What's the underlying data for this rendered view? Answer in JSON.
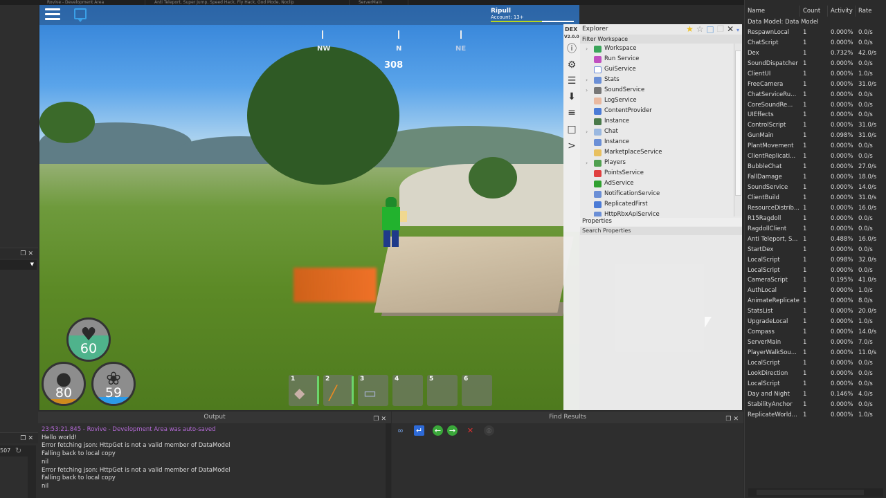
{
  "tabs": [
    {
      "label": "Rovive - Development Area"
    },
    {
      "label": "Anti Teleport, Super Jump, Speed Hack, Fly Hack, God Mode, Noclip"
    },
    {
      "label": "ServerMain"
    }
  ],
  "game": {
    "compass": {
      "labels": [
        "NW",
        "N",
        "NE"
      ],
      "heading": "308"
    },
    "player": {
      "name": "Ripull",
      "account": "Account: 13+",
      "xp_fraction": 0.62
    },
    "stats": {
      "health": {
        "value": "60",
        "fraction": 0.6,
        "color": "#4fb38c"
      },
      "hunger": {
        "value": "80",
        "fraction": 0.12,
        "color": "#d08a1c"
      },
      "thirst": {
        "value": "59",
        "fraction": 0.18,
        "color": "#2b9ae8"
      }
    },
    "hotbar": [
      {
        "num": "1",
        "item": "stone",
        "equipped": true
      },
      {
        "num": "2",
        "item": "torch",
        "equipped": true
      },
      {
        "num": "3",
        "item": "scroll",
        "equipped": false
      },
      {
        "num": "4",
        "item": "",
        "equipped": false
      },
      {
        "num": "5",
        "item": "",
        "equipped": false
      },
      {
        "num": "6",
        "item": "",
        "equipped": false
      }
    ]
  },
  "explorer": {
    "logo": "DEX",
    "version": "V2.0.0",
    "title": "Explorer",
    "filter": "Filter Workspace",
    "properties_label": "Properties",
    "search_properties": "Search Properties",
    "items": [
      {
        "label": "Workspace",
        "expandable": true,
        "icon": "#3aa55a"
      },
      {
        "label": "Run Service",
        "expandable": false,
        "icon": "#c050c0"
      },
      {
        "label": "GuiService",
        "expandable": false,
        "icon": "#ffffff"
      },
      {
        "label": "Stats",
        "expandable": true,
        "icon": "#6b8fd6"
      },
      {
        "label": "SoundService",
        "expandable": true,
        "icon": "#777777"
      },
      {
        "label": "LogService",
        "expandable": false,
        "icon": "#e9b9a0"
      },
      {
        "label": "ContentProvider",
        "expandable": false,
        "icon": "#4b7bd6"
      },
      {
        "label": "Instance",
        "expandable": false,
        "icon": "#4a7a4a"
      },
      {
        "label": "Chat",
        "expandable": true,
        "icon": "#9ab8e0"
      },
      {
        "label": "Instance",
        "expandable": false,
        "icon": "#6b8fd6"
      },
      {
        "label": "MarketplaceService",
        "expandable": false,
        "icon": "#e8c060"
      },
      {
        "label": "Players",
        "expandable": true,
        "icon": "#50a050"
      },
      {
        "label": "PointsService",
        "expandable": false,
        "icon": "#e04040"
      },
      {
        "label": "AdService",
        "expandable": false,
        "icon": "#30a030"
      },
      {
        "label": "NotificationService",
        "expandable": false,
        "icon": "#6b8fd6"
      },
      {
        "label": "ReplicatedFirst",
        "expandable": false,
        "icon": "#4b7bd6"
      },
      {
        "label": "HttpRbxApiService",
        "expandable": false,
        "icon": "#6b8fd6"
      }
    ]
  },
  "output": {
    "title": "Output",
    "lines": [
      {
        "text": "23:53:21.845 - Rovive - Development Area was auto-saved",
        "type": "sys"
      },
      {
        "text": "Hello world!",
        "type": "normal"
      },
      {
        "text": "Error fetching json: HttpGet is not a valid member of DataModel",
        "type": "normal"
      },
      {
        "text": "Falling back to local copy",
        "type": "normal"
      },
      {
        "text": "nil",
        "type": "normal"
      },
      {
        "text": "Error fetching json: HttpGet is not a valid member of DataModel",
        "type": "normal"
      },
      {
        "text": "Falling back to local copy",
        "type": "normal"
      },
      {
        "text": "nil",
        "type": "normal"
      }
    ]
  },
  "find_results": {
    "title": "Find Results"
  },
  "left_panel": {
    "counter": "507"
  },
  "script_performance": {
    "columns": [
      "Name",
      "Count",
      "Activity",
      "Rate"
    ],
    "group": "Data Model: Data Model",
    "rows": [
      [
        "RespawnLocal",
        "1",
        "0.000%",
        "0.0/s"
      ],
      [
        "ChatScript",
        "1",
        "0.000%",
        "0.0/s"
      ],
      [
        "Dex",
        "1",
        "0.732%",
        "42.0/s"
      ],
      [
        "SoundDispatcher",
        "1",
        "0.000%",
        "0.0/s"
      ],
      [
        "ClientUI",
        "1",
        "0.000%",
        "1.0/s"
      ],
      [
        "FreeCamera",
        "1",
        "0.000%",
        "31.0/s"
      ],
      [
        "ChatServiceRu...",
        "1",
        "0.000%",
        "0.0/s"
      ],
      [
        "CoreSoundRe...",
        "1",
        "0.000%",
        "0.0/s"
      ],
      [
        "UIEffects",
        "1",
        "0.000%",
        "0.0/s"
      ],
      [
        "ControlScript",
        "1",
        "0.000%",
        "31.0/s"
      ],
      [
        "GunMain",
        "1",
        "0.098%",
        "31.0/s"
      ],
      [
        "PlantMovement",
        "1",
        "0.000%",
        "0.0/s"
      ],
      [
        "ClientReplicati...",
        "1",
        "0.000%",
        "0.0/s"
      ],
      [
        "BubbleChat",
        "1",
        "0.000%",
        "27.0/s"
      ],
      [
        "FallDamage",
        "1",
        "0.000%",
        "18.0/s"
      ],
      [
        "SoundService",
        "1",
        "0.000%",
        "14.0/s"
      ],
      [
        "ClientBuild",
        "1",
        "0.000%",
        "31.0/s"
      ],
      [
        "ResourceDistrib...",
        "1",
        "0.000%",
        "16.0/s"
      ],
      [
        "R15Ragdoll",
        "1",
        "0.000%",
        "0.0/s"
      ],
      [
        "RagdollClient",
        "1",
        "0.000%",
        "0.0/s"
      ],
      [
        "Anti Teleport, S...",
        "1",
        "0.488%",
        "16.0/s"
      ],
      [
        "StartDex",
        "1",
        "0.000%",
        "0.0/s"
      ],
      [
        "LocalScript",
        "1",
        "0.098%",
        "32.0/s"
      ],
      [
        "LocalScript",
        "1",
        "0.000%",
        "0.0/s"
      ],
      [
        "CameraScript",
        "1",
        "0.195%",
        "41.0/s"
      ],
      [
        "AuthLocal",
        "1",
        "0.000%",
        "1.0/s"
      ],
      [
        "AnimateReplicate",
        "1",
        "0.000%",
        "8.0/s"
      ],
      [
        "StatsList",
        "1",
        "0.000%",
        "20.0/s"
      ],
      [
        "UpgradeLocal",
        "1",
        "0.000%",
        "1.0/s"
      ],
      [
        "Compass",
        "1",
        "0.000%",
        "14.0/s"
      ],
      [
        "ServerMain",
        "1",
        "0.000%",
        "7.0/s"
      ],
      [
        "PlayerWalkSou...",
        "1",
        "0.000%",
        "11.0/s"
      ],
      [
        "LocalScript",
        "1",
        "0.000%",
        "0.0/s"
      ],
      [
        "LookDirection",
        "1",
        "0.000%",
        "0.0/s"
      ],
      [
        "LocalScript",
        "1",
        "0.000%",
        "0.0/s"
      ],
      [
        "Day and Night",
        "1",
        "0.146%",
        "4.0/s"
      ],
      [
        "StabilityAnchor",
        "1",
        "0.000%",
        "0.0/s"
      ],
      [
        "ReplicateWorld...",
        "1",
        "0.000%",
        "1.0/s"
      ]
    ]
  }
}
